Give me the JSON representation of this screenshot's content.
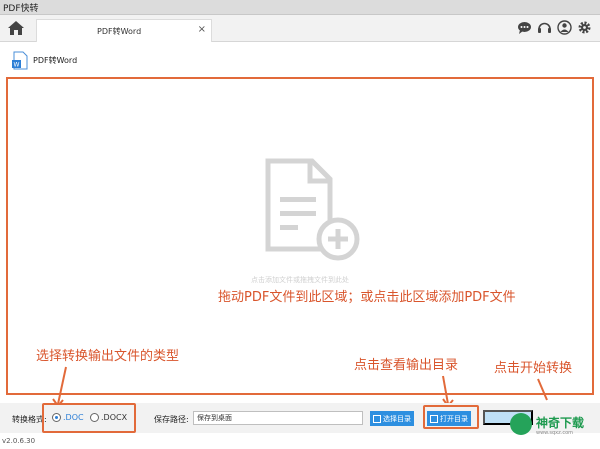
{
  "app": {
    "title": "PDF快转",
    "version": "v2.0.6.30"
  },
  "tabs": [
    {
      "label": "PDF转Word",
      "close": "×"
    }
  ],
  "toolbar_icons": [
    "chat-icon",
    "headset-icon",
    "user-icon",
    "gear-icon"
  ],
  "breadcrumb": {
    "label": "PDF转Word",
    "icon": "word-doc-icon"
  },
  "dropzone": {
    "hint": "点击添加文件或拖拽文件到此处",
    "annotation": "拖动PDF文件到此区域；或点击此区域添加PDF文件"
  },
  "annotations": {
    "format": "选择转换输出文件的类型",
    "open_dir": "点击查看输出目录",
    "start": "点击开始转换"
  },
  "bottom": {
    "format_label": "转换格式:",
    "formats": [
      {
        "label": ".DOC",
        "checked": true
      },
      {
        "label": ".DOCX",
        "checked": false
      }
    ],
    "save_label": "保存路径:",
    "save_path": "保存到桌面",
    "choose_dir": "选择目录",
    "open_dir": "打开目录"
  },
  "watermark": {
    "brand": "神奇下载",
    "site": "www.sqxz.com"
  },
  "colors": {
    "accent": "#2d8fe0",
    "annotation": "#e26a3a",
    "brand": "#1e9a4f"
  }
}
